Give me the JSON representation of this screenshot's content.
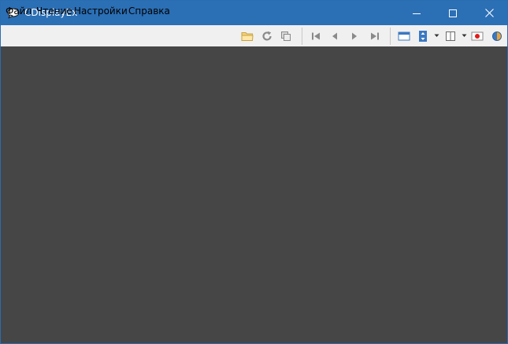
{
  "window": {
    "title": "CDisplayEx"
  },
  "menu": {
    "items": [
      {
        "label": "Файл"
      },
      {
        "label": "Чтение"
      },
      {
        "label": "Настройки"
      },
      {
        "label": "Справка"
      }
    ]
  },
  "toolbar": {
    "icons": [
      "open-folder-icon",
      "refresh-icon",
      "copy-pages-icon",
      "first-page-icon",
      "previous-page-icon",
      "next-page-icon",
      "last-page-icon",
      "fit-width-icon",
      "fit-height-icon",
      "page-layout-icon",
      "record-icon",
      "globe-icon"
    ]
  },
  "colors": {
    "titlebar": "#2b6fb5",
    "menubar": "#f0f0f0",
    "content_background": "#464646",
    "accent": "#2b6cb0"
  }
}
